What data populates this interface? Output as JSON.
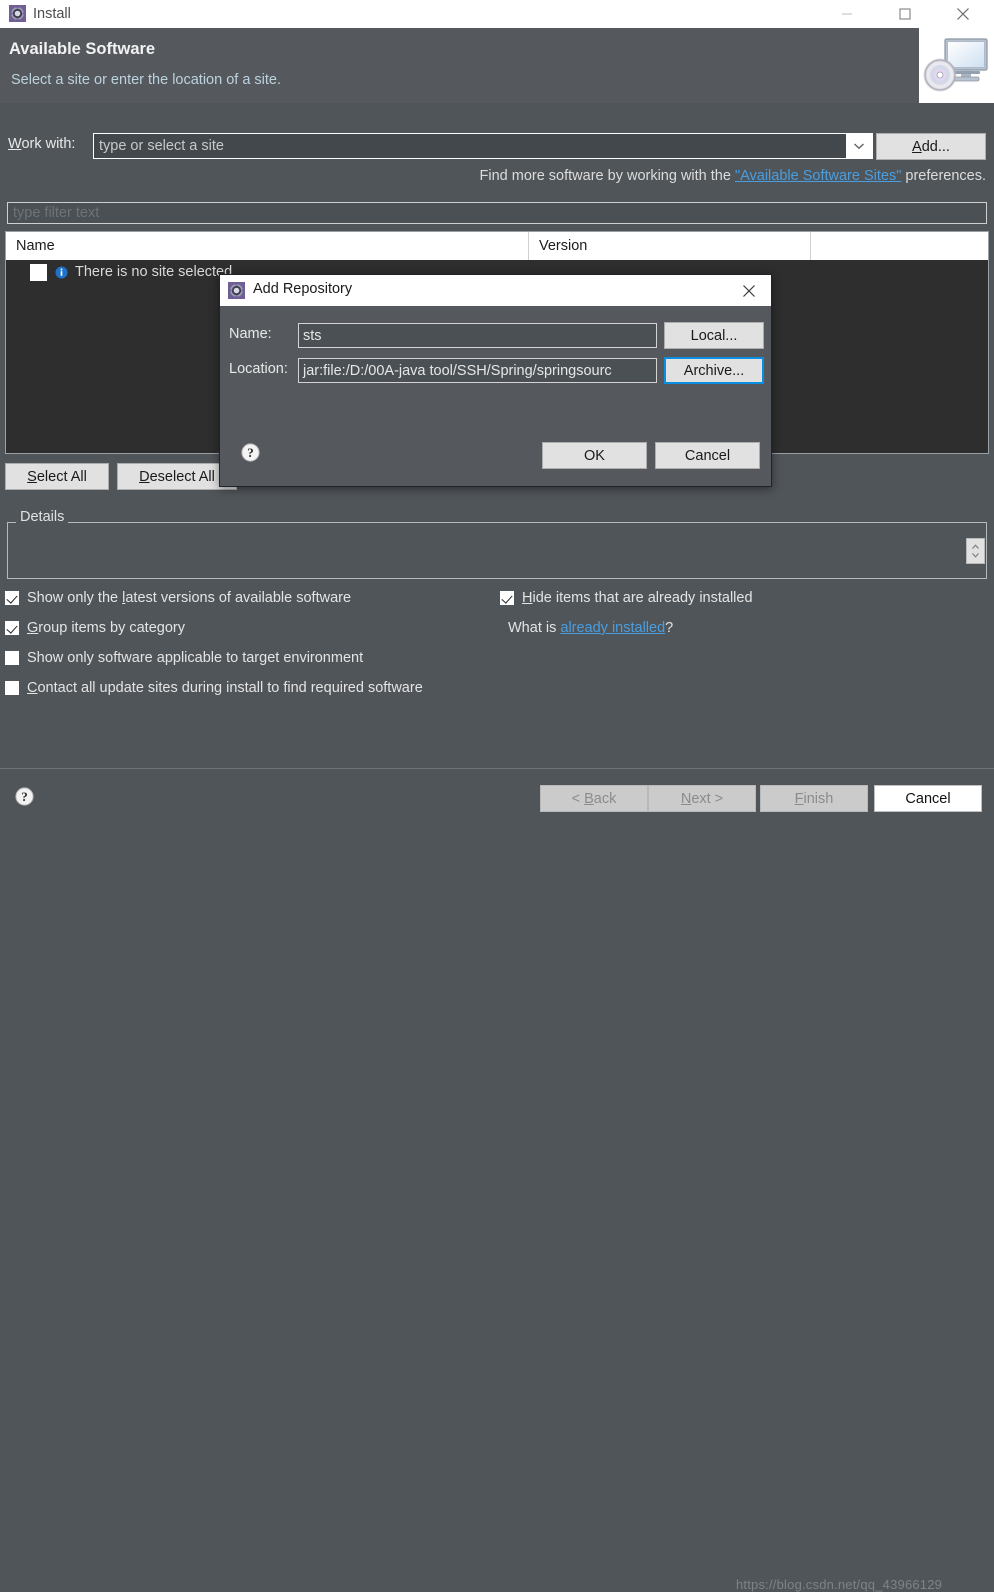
{
  "window": {
    "title": "Install",
    "icon": "eclipse-install-icon",
    "controls": {
      "minimize": "minimize-icon",
      "maximize": "maximize-icon",
      "close": "close-icon"
    }
  },
  "header": {
    "title": "Available Software",
    "subtitle": "Select a site or enter the location of a site.",
    "banner_icon": "computer-cd-icon",
    "title_color": "#f2f2f2",
    "subtitle_color": "#bcd2de"
  },
  "work_with": {
    "label_prefix": "W",
    "label_rest": "ork with:",
    "value": "type or select a site",
    "dropdown_icon": "chevron-down-icon",
    "add_button_prefix": "A",
    "add_button_rest": "dd...",
    "hint_before": "Find more software by working with the ",
    "hint_link": "\"Available Software Sites\"",
    "hint_after": " preferences.",
    "link_color": "#4a9ee0"
  },
  "filter": {
    "placeholder": "type filter text",
    "value": ""
  },
  "table": {
    "columns": [
      "Name",
      "Version",
      ""
    ],
    "rows": [
      {
        "checked": false,
        "icon": "info-icon",
        "name": "There is no site selected.",
        "version": ""
      }
    ]
  },
  "selection_buttons": {
    "select_all_prefix": "S",
    "select_all_rest": "elect All",
    "deselect_all_prefix": "D",
    "deselect_all_rest": "eselect All"
  },
  "details": {
    "legend": "Details",
    "content": "",
    "spinner_icon": "expand-collapse-icon"
  },
  "options": {
    "left": [
      {
        "checked": true,
        "pre": "Show only the ",
        "mn": "l",
        "post": "atest versions of available software"
      },
      {
        "checked": true,
        "pre": "",
        "mn": "G",
        "post": "roup items by category"
      },
      {
        "checked": false,
        "pre": "",
        "mn": "",
        "post": "Show only software applicable to target environment"
      },
      {
        "checked": false,
        "pre": "",
        "mn": "C",
        "post": "ontact all update sites during install to find required software"
      }
    ],
    "right": [
      {
        "checked": true,
        "pre": "",
        "mn": "H",
        "post": "ide items that are already installed"
      }
    ],
    "whatis_before": "What is ",
    "whatis_link": "already installed",
    "whatis_after": "?"
  },
  "wizard_buttons": {
    "help_icon": "help-icon",
    "back_prefix": "< ",
    "back_mn": "B",
    "back_rest": "ack",
    "back_enabled": false,
    "next_mn": "N",
    "next_rest": "ext >",
    "next_enabled": false,
    "finish_mn": "F",
    "finish_rest": "inish",
    "finish_enabled": false,
    "cancel_label": "Cancel",
    "cancel_enabled": true
  },
  "watermark": "https://blog.csdn.net/qq_43966129",
  "dialog": {
    "title": "Add Repository",
    "icon": "eclipse-install-icon",
    "close_icon": "close-icon",
    "name_label": "Name:",
    "name_value": "sts",
    "location_label": "Location:",
    "location_value": "jar:file:/D:/00A-java tool/SSH/Spring/springsourc",
    "local_button": "Local...",
    "archive_button": "Archive...",
    "help_icon": "help-icon",
    "ok_button": "OK",
    "cancel_button": "Cancel",
    "focus_color": "#0a8fe0"
  }
}
